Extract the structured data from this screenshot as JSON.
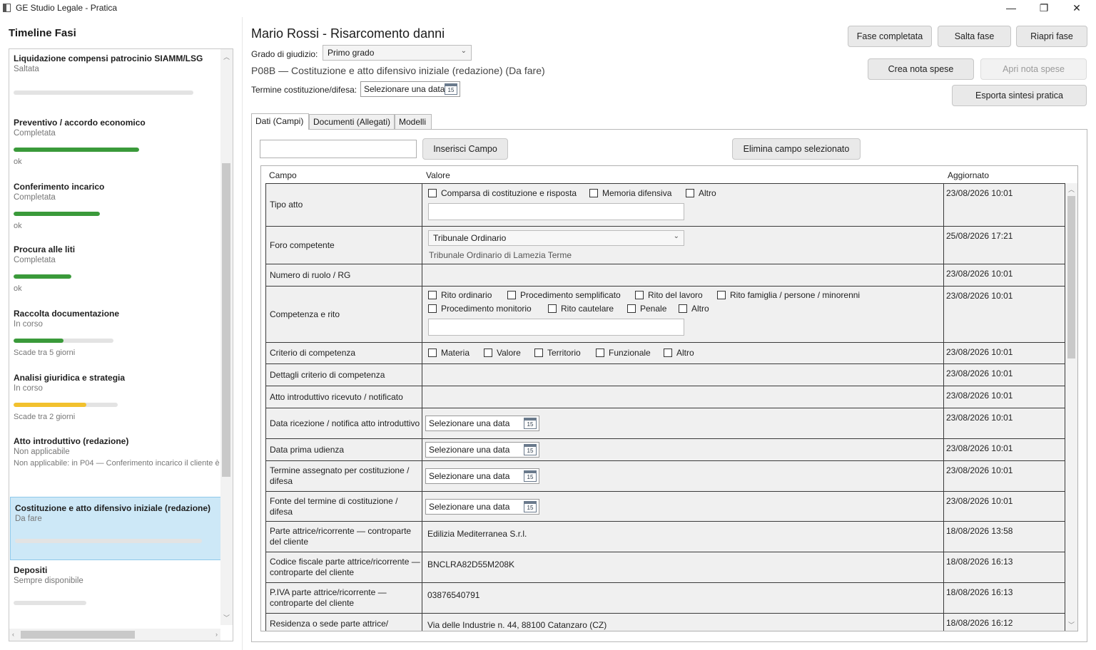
{
  "window": {
    "title": "GE Studio Legale - Pratica",
    "minimize": "—",
    "restore": "❐",
    "close": "✕"
  },
  "sidebar": {
    "title": "Timeline Fasi",
    "phases": [
      {
        "name": "Liquidazione compensi patrocinio SIAMM/LSG",
        "status": "Saltata",
        "note": "",
        "progress": 0,
        "caption": "",
        "color": "#e3e3e3"
      },
      {
        "name": "Preventivo / accordo economico",
        "status": "Completata",
        "note": "",
        "progress": 1.0,
        "caption": "ok",
        "color": "#3a9a3a"
      },
      {
        "name": "Conferimento incarico",
        "status": "Completata",
        "note": "",
        "progress": 1.0,
        "caption": "ok",
        "color": "#3a9a3a"
      },
      {
        "name": "Procura alle liti",
        "status": "Completata",
        "note": "",
        "progress": 1.0,
        "caption": "ok",
        "color": "#3a9a3a"
      },
      {
        "name": "Raccolta documentazione",
        "status": "In corso",
        "note": "",
        "progress": 0.5,
        "caption": "Scade tra 5 giorni",
        "color": "#3a9a3a"
      },
      {
        "name": "Analisi giuridica e strategia",
        "status": "In corso",
        "note": "",
        "progress": 0.7,
        "caption": "Scade tra 2 giorni",
        "color": "#f2c12e"
      },
      {
        "name": "Atto introduttivo (redazione)",
        "status": "Non applicabile",
        "note": "Non applicabile: in P04 — Conferimento incarico il cliente è",
        "progress": 0,
        "caption": "",
        "color": "#e3e3e3"
      },
      {
        "name": "Costituzione e atto difensivo iniziale (redazione)",
        "status": "Da fare",
        "note": "",
        "progress": 0,
        "caption": "",
        "color": "#e3e3e3"
      },
      {
        "name": "Depositi",
        "status": "Sempre disponibile",
        "note": "",
        "progress": 0,
        "caption": "",
        "color": "#e3e3e3"
      }
    ]
  },
  "header": {
    "title": "Mario Rossi - Risarcomento danni",
    "grade_label": "Grado di giudizio:",
    "grade_value": "Primo grado",
    "phase_subtitle": "P08B — Costituzione e atto difensivo iniziale (redazione) (Da fare)",
    "deadline_label": "Termine costituzione/difesa:",
    "deadline_placeholder": "Selezionare una data",
    "cal_day": "15"
  },
  "actions": {
    "complete": "Fase completata",
    "skip": "Salta fase",
    "reopen": "Riapri fase",
    "create_expense": "Crea nota spese",
    "open_expense": "Apri nota spese",
    "export": "Esporta sintesi pratica"
  },
  "tabs": [
    {
      "label": "Dati (Campi)",
      "active": true
    },
    {
      "label": "Documenti (Allegati)",
      "active": false
    },
    {
      "label": "Modelli",
      "active": false
    }
  ],
  "toolbar": {
    "insert": "Inserisci Campo",
    "delete": "Elimina campo selezionato"
  },
  "grid": {
    "headers": {
      "campo": "Campo",
      "valore": "Valore",
      "aggiornato": "Aggiornato"
    },
    "date_placeholder": "Selezionare una data",
    "rows": [
      {
        "campo": "Tipo atto",
        "updated": "23/08/2026 10:01",
        "options": [
          "Comparsa di costituzione e risposta",
          "Memoria difensiva",
          "Altro"
        ]
      },
      {
        "campo": "Foro competente",
        "updated": "25/08/2026 17:21",
        "select": "Tribunale Ordinario",
        "sub": "Tribunale Ordinario di Lamezia Terme"
      },
      {
        "campo": "Numero di ruolo / RG",
        "updated": "23/08/2026 10:01"
      },
      {
        "campo": "Competenza e rito",
        "updated": "23/08/2026 10:01",
        "options1": [
          "Rito ordinario",
          "Procedimento semplificato",
          "Rito del lavoro",
          "Rito famiglia / persone / minorenni"
        ],
        "options2": [
          "Procedimento monitorio",
          "Rito cautelare",
          "Penale",
          "Altro"
        ]
      },
      {
        "campo": "Criterio di competenza",
        "updated": "23/08/2026 10:01",
        "options": [
          "Materia",
          "Valore",
          "Territorio",
          "Funzionale",
          "Altro"
        ]
      },
      {
        "campo": "Dettagli criterio di competenza",
        "updated": "23/08/2026 10:01"
      },
      {
        "campo": "Atto introduttivo ricevuto / notificato",
        "updated": "23/08/2026 10:01"
      },
      {
        "campo": "Data ricezione / notifica atto introduttivo",
        "updated": "23/08/2026 10:01"
      },
      {
        "campo": "Data prima udienza",
        "updated": "23/08/2026 10:01"
      },
      {
        "campo": "Termine assegnato per costituzione / difesa",
        "updated": "23/08/2026 10:01"
      },
      {
        "campo": "Fonte del termine di costituzione / difesa",
        "updated": "23/08/2026 10:01"
      },
      {
        "campo": "Parte attrice/ricorrente — controparte del cliente",
        "updated": "18/08/2026 13:58",
        "value": "Edilizia Mediterranea S.r.l."
      },
      {
        "campo": "Codice fiscale parte attrice/ricorrente — controparte del cliente",
        "updated": "18/08/2026 16:13",
        "value": "BNCLRA82D55M208K"
      },
      {
        "campo": "P.IVA parte attrice/ricorrente — controparte del cliente",
        "updated": "18/08/2026 16:13",
        "value": "03876540791"
      },
      {
        "campo": "Residenza o sede parte attrice/",
        "updated": "18/08/2026 16:12",
        "value": "Via delle Industrie n. 44, 88100 Catanzaro (CZ)"
      }
    ]
  }
}
